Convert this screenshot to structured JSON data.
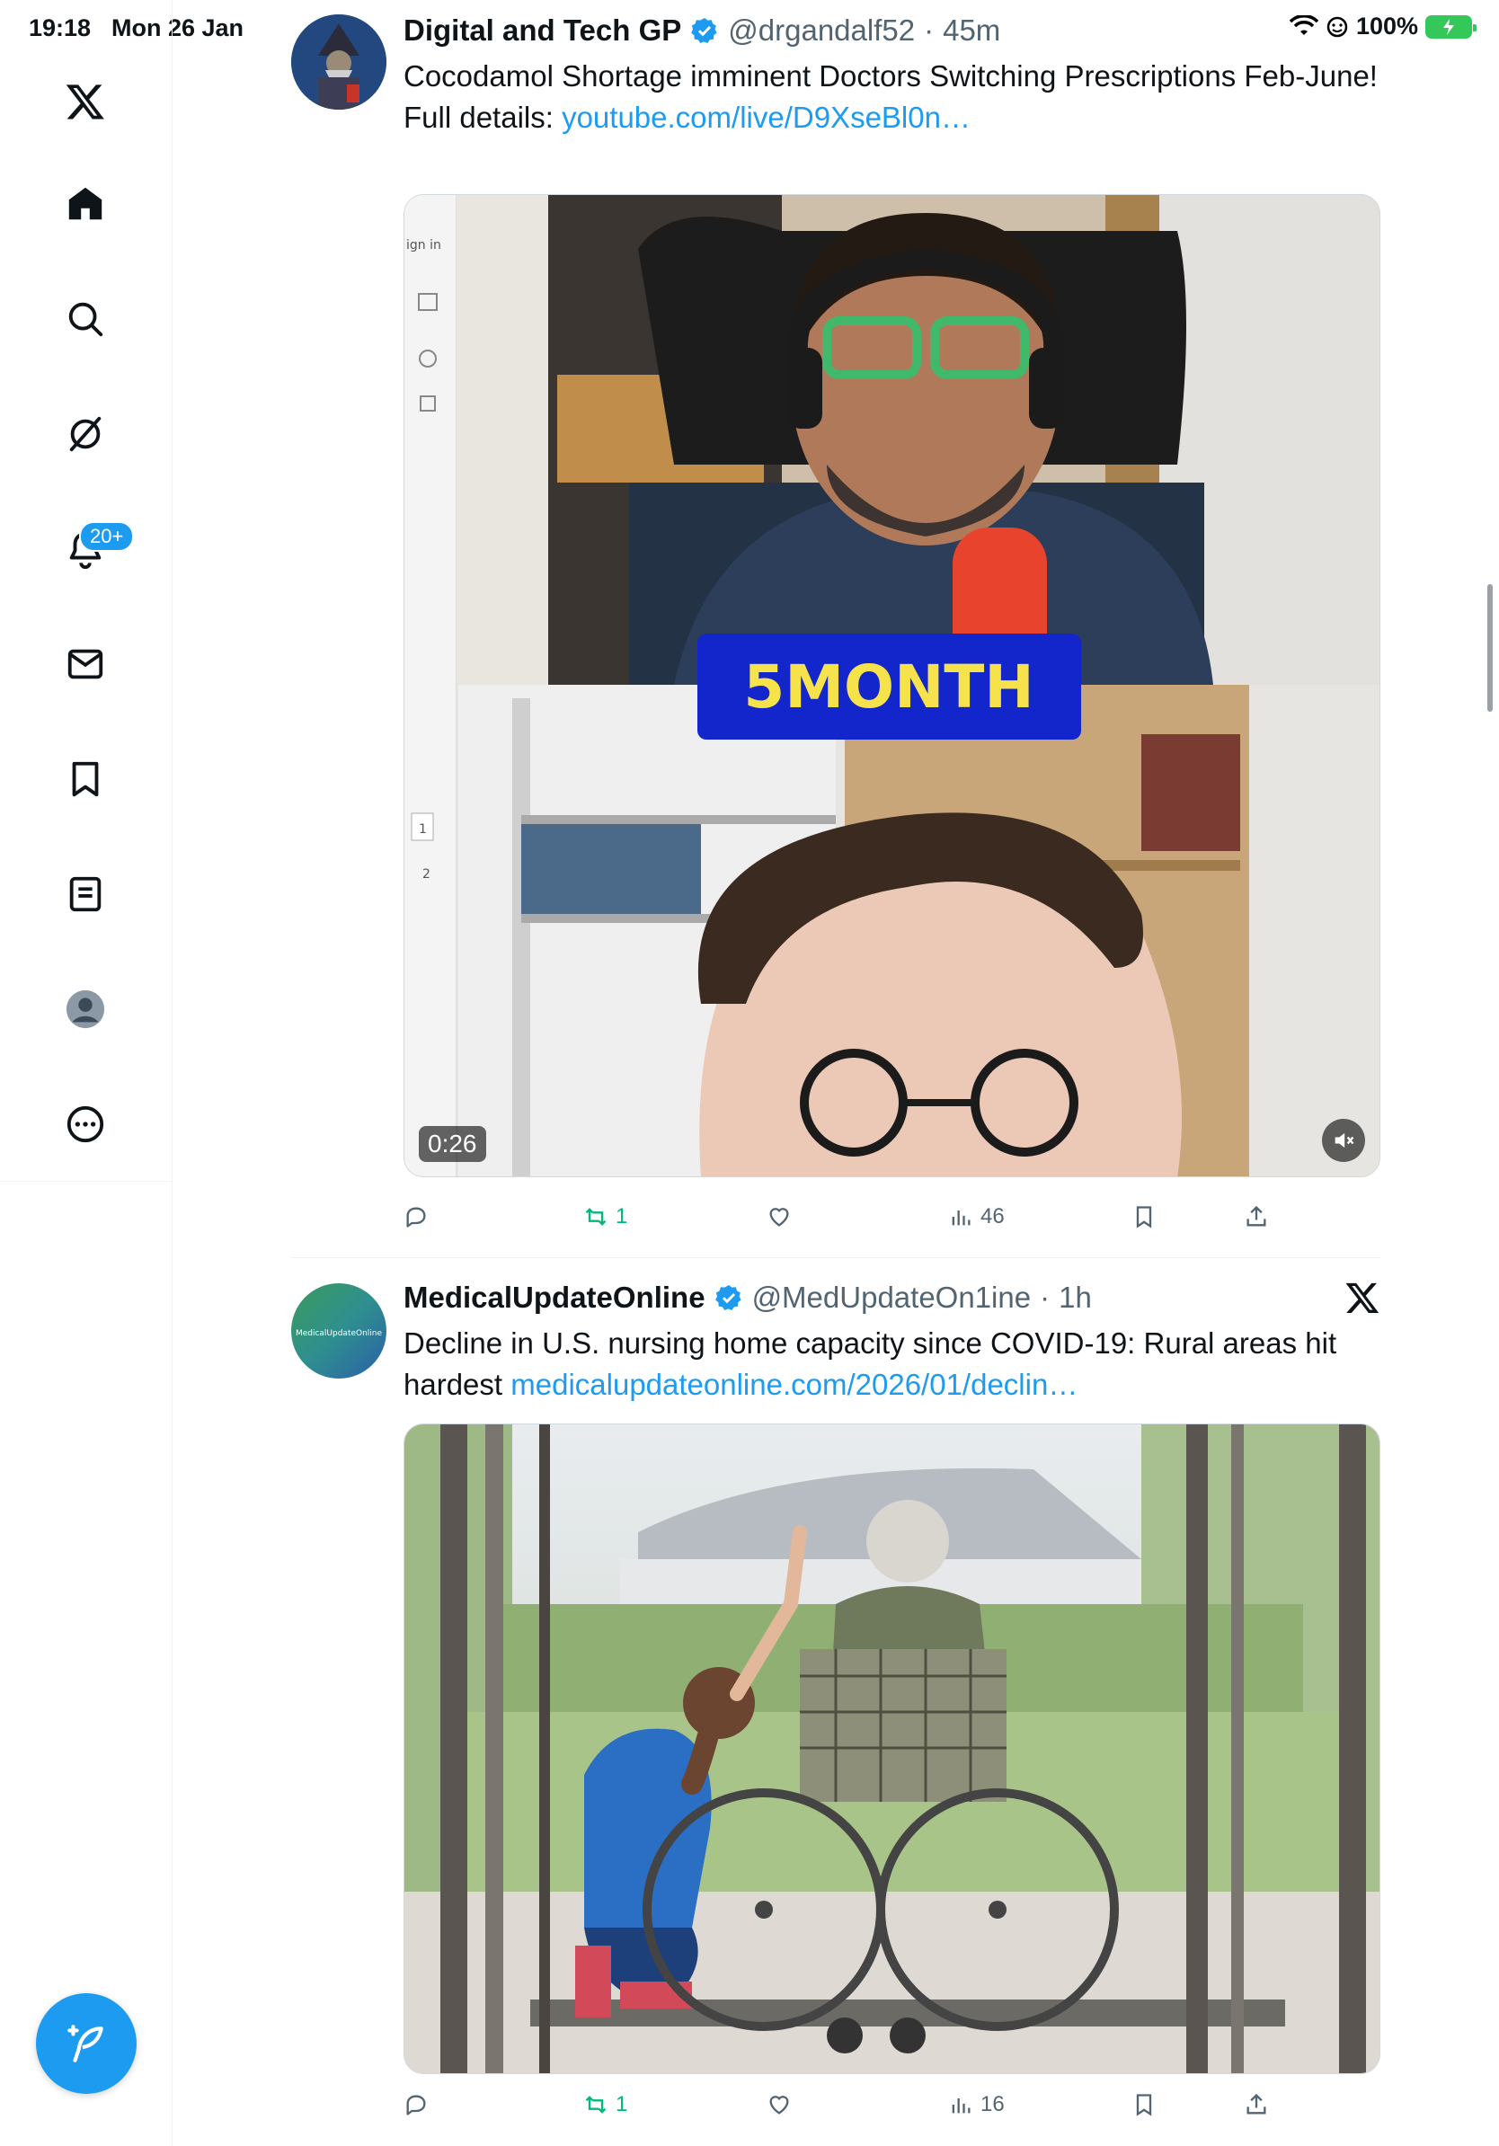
{
  "status_bar": {
    "time": "19:18",
    "date": "Mon 26 Jan",
    "battery_text": "100%"
  },
  "sidebar": {
    "items": [
      {
        "name": "x-logo"
      },
      {
        "name": "home"
      },
      {
        "name": "search"
      },
      {
        "name": "grok"
      },
      {
        "name": "notifications",
        "badge": "20+"
      },
      {
        "name": "messages"
      },
      {
        "name": "bookmarks"
      },
      {
        "name": "lists"
      },
      {
        "name": "profile"
      },
      {
        "name": "more"
      }
    ],
    "accent": "#1d9bf0"
  },
  "tweets": [
    {
      "name": "Digital and Tech GP",
      "handle": "@drgandalf52",
      "dot": "·",
      "time": "45m",
      "text": "Cocodamol Shortage imminent Doctors Switching Prescriptions Feb-June!",
      "text_prefix": "Full details: ",
      "link": "youtube.com/live/D9XseBl0n…",
      "media": {
        "type": "video",
        "overlay_text": "5MONTH",
        "duration": "0:26",
        "sidebar_label": "ign in",
        "sidebar_nums": [
          "1",
          "2"
        ]
      },
      "actions": {
        "reply": "",
        "retweet": "1",
        "like": "",
        "views": "46"
      }
    },
    {
      "name": "MedicalUpdateOnline",
      "handle": "@MedUpdateOn1ine",
      "dot": "·",
      "time": "1h",
      "avatar_text": "MedicalUpdateOnline",
      "text": "Decline in U.S. nursing home capacity since COVID-19: Rural areas hit hardest ",
      "link": "medicalupdateonline.com/2026/01/declin…",
      "media": {
        "type": "photo"
      },
      "actions": {
        "reply": "",
        "retweet": "1",
        "like": "",
        "views": "16"
      }
    }
  ]
}
